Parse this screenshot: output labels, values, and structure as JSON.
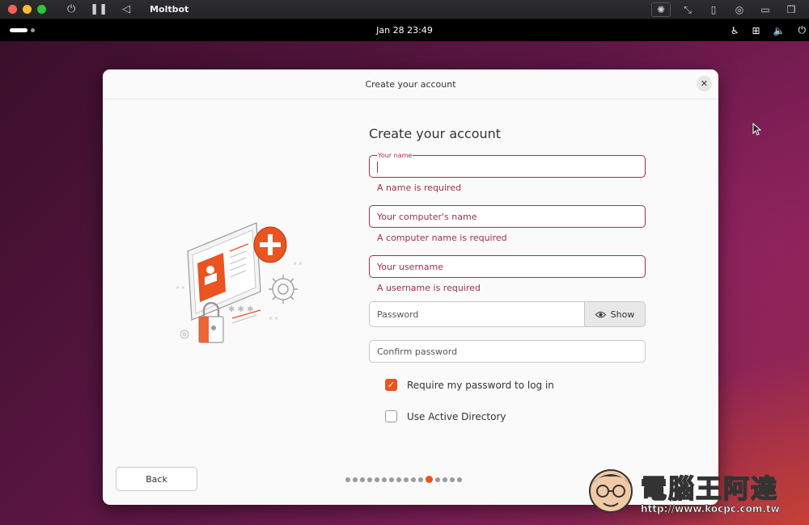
{
  "host": {
    "app_title": "Moltbot"
  },
  "topbar": {
    "datetime": "Jan 28  23:49"
  },
  "dialog": {
    "window_title": "Create your account",
    "heading": "Create your account",
    "fields": {
      "name": {
        "floating_label": "Your name",
        "value": "",
        "error": "A name is required"
      },
      "computer_name": {
        "placeholder": "Your computer's name",
        "error": "A computer name is required"
      },
      "username": {
        "placeholder": "Your username",
        "error": "A username is required"
      },
      "password": {
        "placeholder": "Password",
        "show_label": "Show"
      },
      "confirm_password": {
        "placeholder": "Confirm password"
      }
    },
    "options": {
      "require_password": {
        "label": "Require my password to log in",
        "checked": true
      },
      "active_directory": {
        "label": "Use Active Directory",
        "checked": false
      }
    },
    "back_label": "Back",
    "progress": {
      "total_steps": 16,
      "current_step": 12
    }
  },
  "colors": {
    "accent": "#e95420",
    "error": "#a0304a"
  },
  "watermark": {
    "text": "電腦王阿達",
    "url": "http://www.kocpc.com.tw"
  }
}
